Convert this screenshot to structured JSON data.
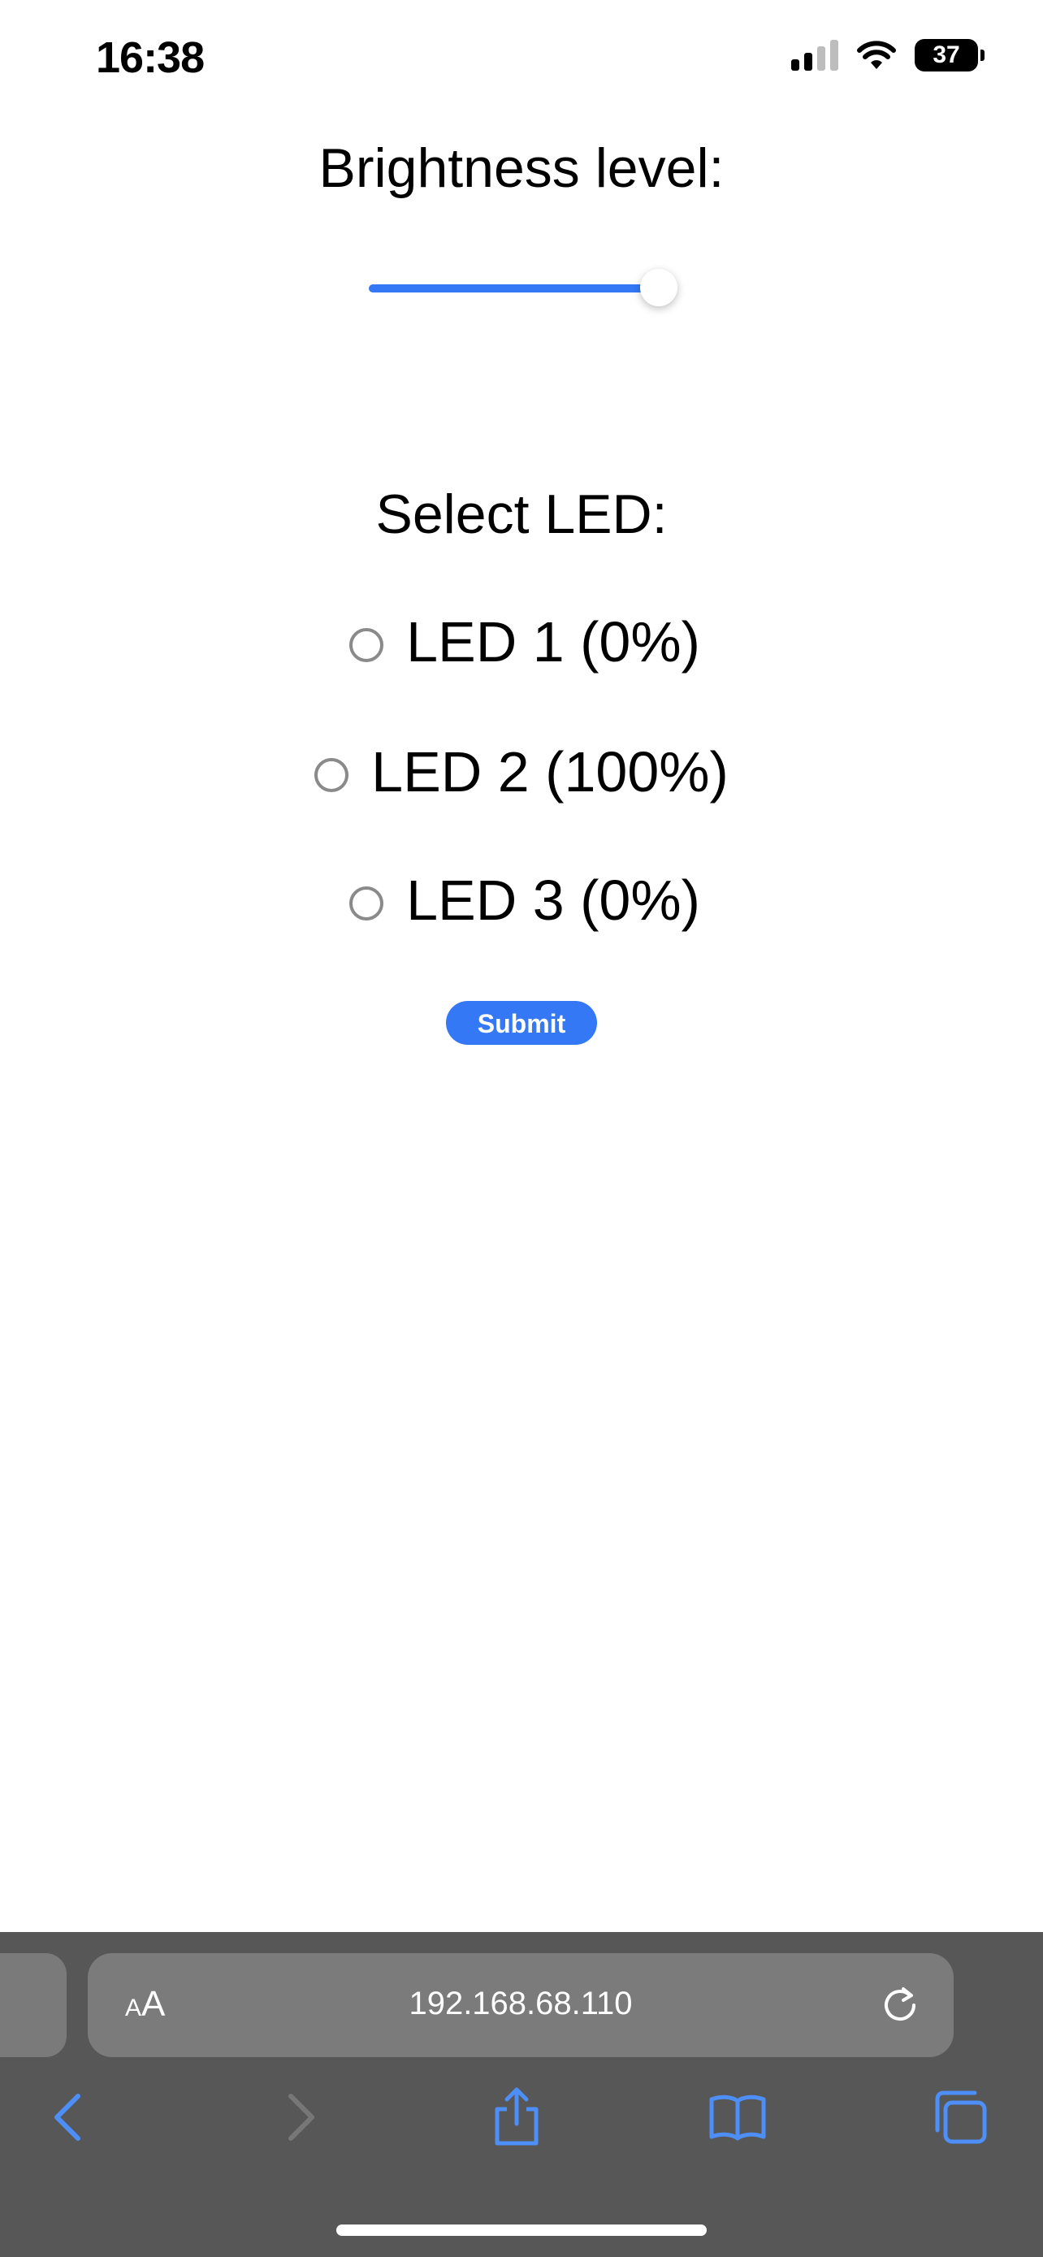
{
  "status_bar": {
    "time": "16:38",
    "battery": "37",
    "icons": [
      "signal-icon",
      "wifi-icon",
      "battery-icon"
    ]
  },
  "brightness": {
    "label": "Brightness level:",
    "value_fraction": 1.0,
    "accent_color": "#3478f6"
  },
  "led_select": {
    "label": "Select LED:",
    "options": [
      {
        "label": "LED 1 (0%)",
        "selected": false
      },
      {
        "label": "LED 2 (100%)",
        "selected": false
      },
      {
        "label": "LED 3 (0%)",
        "selected": false
      }
    ]
  },
  "submit_label": "Submit",
  "browser": {
    "aa_small": "A",
    "aa_large": "A",
    "url": "192.168.68.110",
    "toolbar_icons": [
      "back-icon",
      "forward-icon",
      "share-icon",
      "bookmarks-icon",
      "tabs-icon",
      "reload-icon"
    ]
  }
}
